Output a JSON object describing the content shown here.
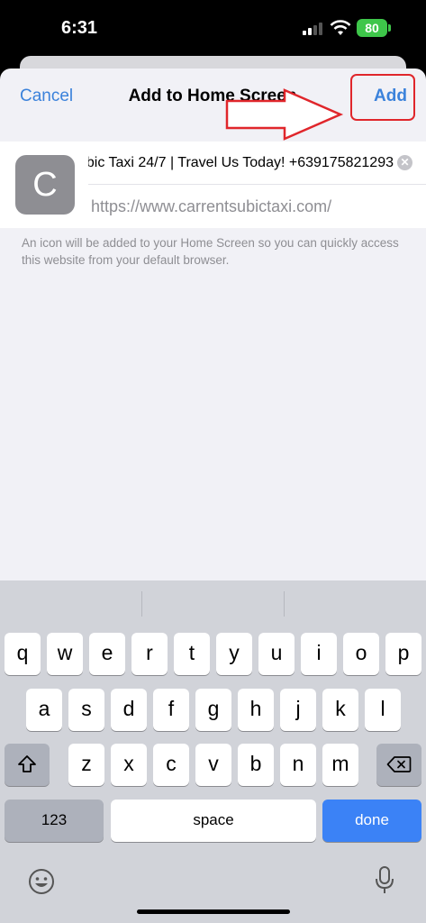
{
  "status": {
    "time": "6:31",
    "battery": "80"
  },
  "nav": {
    "cancel": "Cancel",
    "title": "Add to Home Screen",
    "add": "Add"
  },
  "bookmark": {
    "icon_letter": "C",
    "title": "bic Taxi 24/7 | Travel Us Today! +639175821293",
    "url": "https://www.carrentsubictaxi.com/"
  },
  "hint": "An icon will be added to your Home Screen so you can quickly access this website from your default browser.",
  "keyboard": {
    "row1": [
      "q",
      "w",
      "e",
      "r",
      "t",
      "y",
      "u",
      "i",
      "o",
      "p"
    ],
    "row2": [
      "a",
      "s",
      "d",
      "f",
      "g",
      "h",
      "j",
      "k",
      "l"
    ],
    "row3": [
      "z",
      "x",
      "c",
      "v",
      "b",
      "n",
      "m"
    ],
    "numbers": "123",
    "space": "space",
    "done": "done"
  },
  "icons": {
    "signal": "cellular-signal-icon",
    "wifi": "wifi-icon",
    "shift": "shift-icon",
    "backspace": "backspace-icon",
    "emoji": "emoji-icon",
    "mic": "microphone-icon",
    "arrow": "red-arrow-annotation"
  },
  "colors": {
    "accent": "#3b82db",
    "annotation": "#e0262b",
    "done": "#3b82f6"
  }
}
